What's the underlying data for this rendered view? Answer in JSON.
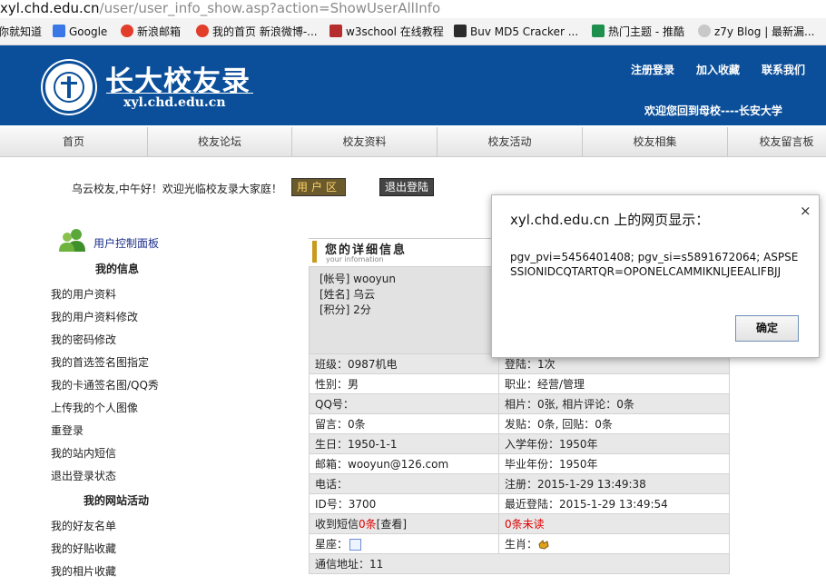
{
  "browser": {
    "url_host": "xyl.chd.edu.cn",
    "url_path": "/user/user_info_show.asp?action=ShowUserAllInfo",
    "bookmarks": [
      {
        "label": "你就知道",
        "icon": "bookmark-icon"
      },
      {
        "label": "Google",
        "icon": "google-icon"
      },
      {
        "label": "新浪邮箱",
        "icon": "sina-icon"
      },
      {
        "label": "我的首页 新浪微博-...",
        "icon": "weibo-icon"
      },
      {
        "label": "w3school 在线教程",
        "icon": "w3school-icon"
      },
      {
        "label": "Buv MD5 Cracker ...",
        "icon": "md5-icon"
      },
      {
        "label": "热门主题 - 推酷",
        "icon": "tuicool-icon"
      },
      {
        "label": "z7y Blog | 最新漏...",
        "icon": "blog-icon"
      }
    ]
  },
  "header": {
    "title": "长大校友录",
    "domain": "xyl.chd.edu.cn",
    "links": {
      "register": "注册登录",
      "favorite": "加入收藏",
      "contact": "联系我们"
    },
    "welcome": "欢迎您回到母校----长安大学"
  },
  "nav": [
    "首页",
    "校友论坛",
    "校友资料",
    "校友活动",
    "校友相集",
    "校友留言板"
  ],
  "greeting": {
    "text": "乌云校友,中午好！欢迎光临校友录大家庭！",
    "user_zone": "用户区",
    "logout": "退出登陆"
  },
  "sidebar": {
    "panel_title": "用户控制面板",
    "section_info": "我的信息",
    "info_links": [
      "我的用户资料",
      "我的用户资料修改",
      "我的密码修改",
      "我的首选签名图指定",
      "我的卡通签名图/QQ秀",
      "上传我的个人图像",
      "重登录",
      "我的站内短信",
      "退出登录状态"
    ],
    "section_activity": "我的网站活动",
    "activity_links": [
      "我的好友名单",
      "我的好贴收藏",
      "我的相片收藏"
    ]
  },
  "detail": {
    "title": "您的详细信息",
    "subtitle": "your infomation",
    "account": "[帐号] wooyun",
    "name": "[姓名] 乌云",
    "points": "[积分] 2分",
    "rows": [
      {
        "left": "班级：0987机电",
        "right": "登陆：1次"
      },
      {
        "left": "性别：男",
        "right": "职业：经营/管理"
      },
      {
        "left": "QQ号：",
        "right": "相片：0张, 相片评论：0条"
      },
      {
        "left": "留言：0条",
        "right": "发贴：0条, 回贴：0条"
      },
      {
        "left": "生日：1950-1-1",
        "right": "入学年份：1950年"
      },
      {
        "left": "邮箱：wooyun@126.com",
        "right": "毕业年份：1950年"
      },
      {
        "left": "电话：",
        "right": "注册：2015-1-29 13:49:38"
      },
      {
        "left": "ID号：3700",
        "right": "最近登陆：2015-1-29 13:49:54"
      }
    ],
    "sms_prefix": "收到短信",
    "sms_count": "0条",
    "sms_view": "[查看]",
    "unread": "0条未读",
    "star_label": "星座：",
    "zodiac_label": "生肖：",
    "address": "通信地址：11"
  },
  "dialog": {
    "title": "xyl.chd.edu.cn 上的网页显示：",
    "message": "pgv_pvi=5456401408; pgv_si=s5891672064; ASPSESSIONIDCQTARTQR=OPONELCAMMIKNLJEEALIFBJJ",
    "ok": "确定",
    "close": "×"
  },
  "colors": {
    "header_bg": "#0b4f9a",
    "accent_gold": "#c99a1f",
    "alert_red": "#e00000"
  }
}
